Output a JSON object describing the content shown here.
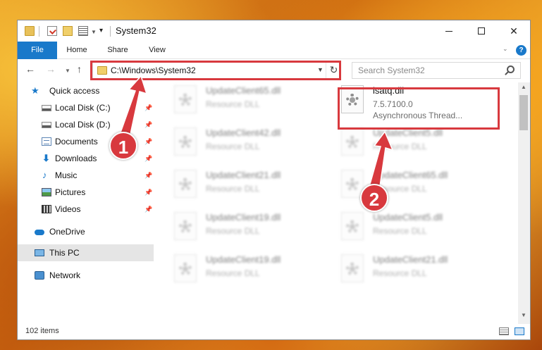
{
  "window": {
    "title": "System32",
    "controls": {
      "minimize": "minimize-icon",
      "maximize": "maximize-icon",
      "close": "✕"
    }
  },
  "ribbon": {
    "tabs": [
      {
        "label": "File"
      },
      {
        "label": "Home"
      },
      {
        "label": "Share"
      },
      {
        "label": "View"
      }
    ],
    "help": "?"
  },
  "nav": {
    "back": "←",
    "forward": "→",
    "up": "↑",
    "address": "C:\\Windows\\System32",
    "refresh": "↻",
    "search_placeholder": "Search System32"
  },
  "sidebar": {
    "items": [
      {
        "label": "Quick access",
        "icon": "star-icon"
      },
      {
        "label": "Local Disk (C:)",
        "icon": "drive-icon",
        "pinned": true
      },
      {
        "label": "Local Disk (D:)",
        "icon": "drive-icon",
        "pinned": true
      },
      {
        "label": "Documents",
        "icon": "documents-icon",
        "pinned": true
      },
      {
        "label": "Downloads",
        "icon": "downloads-icon",
        "pinned": true
      },
      {
        "label": "Music",
        "icon": "music-icon",
        "pinned": true
      },
      {
        "label": "Pictures",
        "icon": "pictures-icon",
        "pinned": true
      },
      {
        "label": "Videos",
        "icon": "videos-icon",
        "pinned": true
      },
      {
        "label": "OneDrive",
        "icon": "cloud-icon"
      },
      {
        "label": "This PC",
        "icon": "computer-icon",
        "selected": true
      },
      {
        "label": "Network",
        "icon": "network-icon"
      }
    ]
  },
  "files": {
    "highlighted": {
      "name": "isatq.dll",
      "version": "7.5.7100.0",
      "description": "Asynchronous Thread..."
    },
    "left_column": [
      {
        "name": "UpdateClient65.dll",
        "type": "Resource DLL"
      },
      {
        "name": "UpdateClient42.dll",
        "type": "Resource DLL"
      },
      {
        "name": "UpdateClient21.dll",
        "type": "Resource DLL"
      },
      {
        "name": "UpdateClient19.dll",
        "type": "Resource DLL"
      },
      {
        "name": "UpdateClient19.dll",
        "type": "Resource DLL"
      }
    ],
    "right_column": [
      {
        "name": "UpdateClient5.dll",
        "type": "Resource DLL"
      },
      {
        "name": "UpdateClient65.dll",
        "type": "Resource DLL"
      },
      {
        "name": "UpdateClient5.dll",
        "type": "Resource DLL"
      },
      {
        "name": "UpdateClient21.dll",
        "type": "Resource DLL"
      }
    ]
  },
  "status": {
    "item_count": "102 items"
  },
  "annotations": {
    "step1": "1",
    "step2": "2",
    "color": "#d8393e"
  },
  "colors": {
    "accent": "#1979ca"
  }
}
